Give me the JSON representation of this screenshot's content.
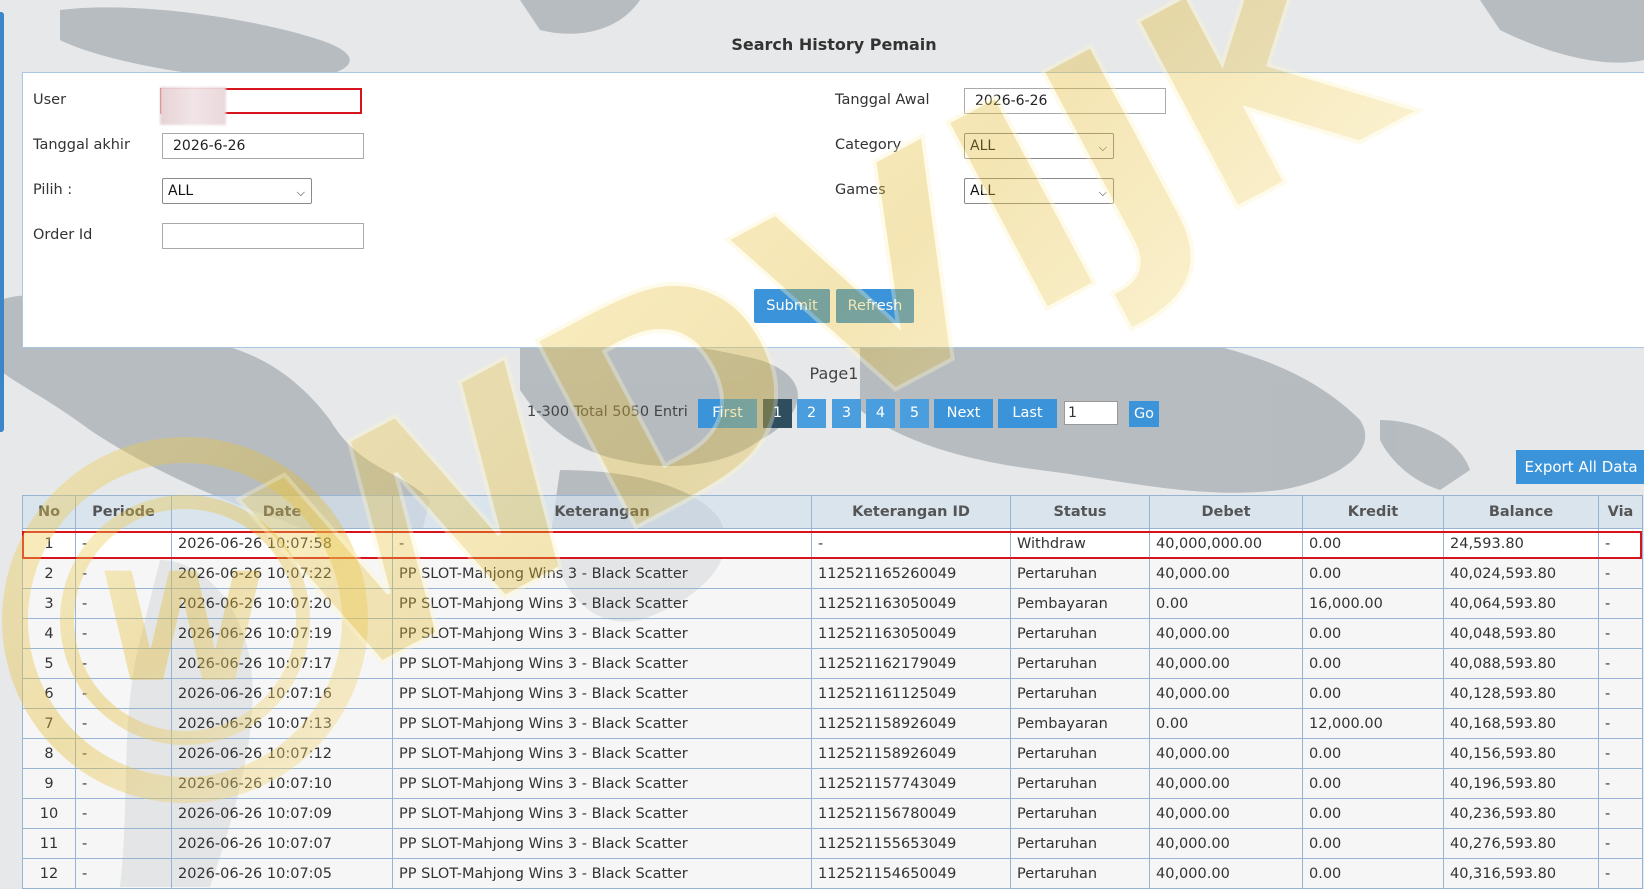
{
  "title": "Search History Pemain",
  "form": {
    "user_label": "User",
    "user_value": "",
    "tanggal_awal_label": "Tanggal Awal",
    "tanggal_awal_value": "2026-6-26",
    "tanggal_akhir_label": "Tanggal akhir",
    "tanggal_akhir_value": "2026-6-26",
    "category_label": "Category",
    "category_value": "ALL",
    "pilih_label": "Pilih  :",
    "pilih_value": "ALL",
    "games_label": "Games",
    "games_value": "ALL",
    "order_label": "Order Id",
    "order_value": "",
    "submit": "Submit",
    "refresh": "Refresh"
  },
  "pager": {
    "page_label": "Page1",
    "total": "1-300 Total 5050 Entri",
    "first": "First",
    "pages": [
      "1",
      "2",
      "3",
      "4",
      "5"
    ],
    "next": "Next",
    "last": "Last",
    "goto_value": "1",
    "go": "Go"
  },
  "export": "Export All Data",
  "table": {
    "headers": [
      "No",
      "Periode",
      "Date",
      "Keterangan",
      "Keterangan ID",
      "Status",
      "Debet",
      "Kredit",
      "Balance",
      "Via"
    ],
    "rows": [
      [
        "1",
        "-",
        "2026-06-26 10:07:58",
        "-",
        "-",
        "Withdraw",
        "40,000,000.00",
        "0.00",
        "24,593.80",
        "-"
      ],
      [
        "2",
        "-",
        "2026-06-26 10:07:22",
        "PP SLOT-Mahjong Wins 3 - Black Scatter",
        "112521165260049",
        "Pertaruhan",
        "40,000.00",
        "0.00",
        "40,024,593.80",
        "-"
      ],
      [
        "3",
        "-",
        "2026-06-26 10:07:20",
        "PP SLOT-Mahjong Wins 3 - Black Scatter",
        "112521163050049",
        "Pembayaran",
        "0.00",
        "16,000.00",
        "40,064,593.80",
        "-"
      ],
      [
        "4",
        "-",
        "2026-06-26 10:07:19",
        "PP SLOT-Mahjong Wins 3 - Black Scatter",
        "112521163050049",
        "Pertaruhan",
        "40,000.00",
        "0.00",
        "40,048,593.80",
        "-"
      ],
      [
        "5",
        "-",
        "2026-06-26 10:07:17",
        "PP SLOT-Mahjong Wins 3 - Black Scatter",
        "112521162179049",
        "Pertaruhan",
        "40,000.00",
        "0.00",
        "40,088,593.80",
        "-"
      ],
      [
        "6",
        "-",
        "2026-06-26 10:07:16",
        "PP SLOT-Mahjong Wins 3 - Black Scatter",
        "112521161125049",
        "Pertaruhan",
        "40,000.00",
        "0.00",
        "40,128,593.80",
        "-"
      ],
      [
        "7",
        "-",
        "2026-06-26 10:07:13",
        "PP SLOT-Mahjong Wins 3 - Black Scatter",
        "112521158926049",
        "Pembayaran",
        "0.00",
        "12,000.00",
        "40,168,593.80",
        "-"
      ],
      [
        "8",
        "-",
        "2026-06-26 10:07:12",
        "PP SLOT-Mahjong Wins 3 - Black Scatter",
        "112521158926049",
        "Pertaruhan",
        "40,000.00",
        "0.00",
        "40,156,593.80",
        "-"
      ],
      [
        "9",
        "-",
        "2026-06-26 10:07:10",
        "PP SLOT-Mahjong Wins 3 - Black Scatter",
        "112521157743049",
        "Pertaruhan",
        "40,000.00",
        "0.00",
        "40,196,593.80",
        "-"
      ],
      [
        "10",
        "-",
        "2026-06-26 10:07:09",
        "PP SLOT-Mahjong Wins 3 - Black Scatter",
        "112521156780049",
        "Pertaruhan",
        "40,000.00",
        "0.00",
        "40,236,593.80",
        "-"
      ],
      [
        "11",
        "-",
        "2026-06-26 10:07:07",
        "PP SLOT-Mahjong Wins 3 - Black Scatter",
        "112521155653049",
        "Pertaruhan",
        "40,000.00",
        "0.00",
        "40,276,593.80",
        "-"
      ],
      [
        "12",
        "-",
        "2026-06-26 10:07:05",
        "PP SLOT-Mahjong Wins 3 - Black Scatter",
        "112521154650049",
        "Pertaruhan",
        "40,000.00",
        "0.00",
        "40,316,593.80",
        "-"
      ]
    ]
  },
  "watermark": "WDVIJK",
  "colors": {
    "accent": "#3b94d9",
    "active_page": "#2e4e5f",
    "link": "#2f7cc4",
    "highlight_red": "#d7141b",
    "watermark_gold": "#e0bd3d"
  }
}
